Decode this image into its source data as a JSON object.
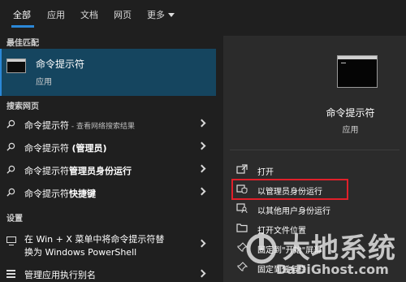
{
  "tabs": [
    {
      "label": "全部"
    },
    {
      "label": "应用"
    },
    {
      "label": "文档"
    },
    {
      "label": "网页"
    },
    {
      "label": "更多"
    }
  ],
  "left": {
    "best_match_label": "最佳匹配",
    "best_match": {
      "title": "命令提示符",
      "subtitle": "应用"
    },
    "web_label": "搜索网页",
    "web_results": [
      {
        "main": "命令提示符",
        "extra": " - 查看网络搜索结果"
      },
      {
        "main": "命令提示符 ",
        "extra_bold": "(管理员)"
      },
      {
        "main": "命令提示符",
        "extra_bold": "管理员身份运行"
      },
      {
        "main": "命令提示符",
        "extra_bold": "快捷键"
      }
    ],
    "settings_label": "设置",
    "settings_item": {
      "line1": "在 Win + X 菜单中将命令提示符替",
      "line2": "换为 Windows PowerShell"
    },
    "admin_item": "管理应用执行别名"
  },
  "right": {
    "title": "命令提示符",
    "subtitle": "应用",
    "actions": [
      {
        "label": "打开",
        "icon": "open-icon"
      },
      {
        "label": "以管理员身份运行",
        "icon": "shield-icon"
      },
      {
        "label": "以其他用户身份运行",
        "icon": "user-icon"
      },
      {
        "label": "打开文件位置",
        "icon": "folder-icon"
      },
      {
        "label": "固定到\"开始\"屏幕",
        "icon": "pin-icon"
      },
      {
        "label": "固定到任务栏",
        "icon": "pin-icon"
      }
    ]
  },
  "watermark": {
    "big": "大地系统",
    "small": "DaDiGhost.com"
  },
  "colors": {
    "accent": "#2b88d8",
    "highlight_border": "#e0202a",
    "selected_bg": "#15455f"
  }
}
